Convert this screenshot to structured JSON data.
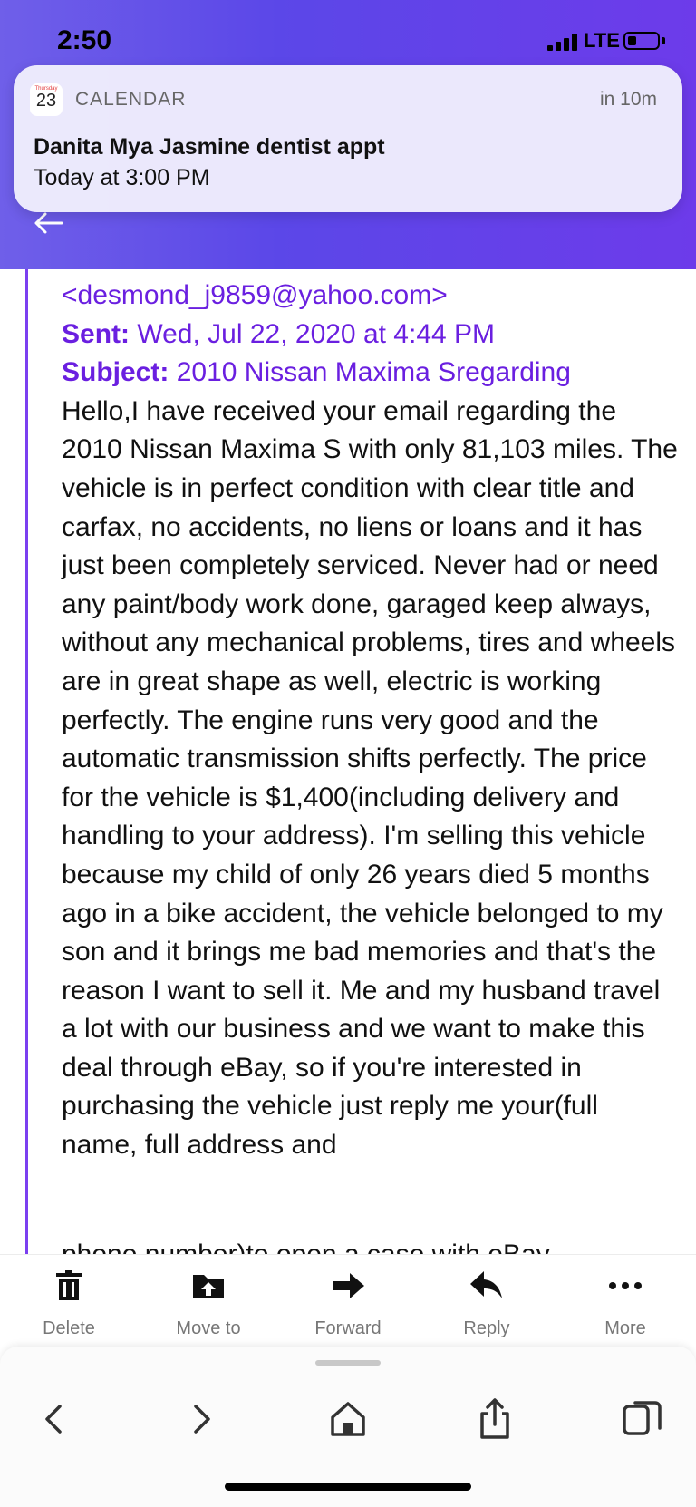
{
  "status_bar": {
    "time": "2:50",
    "network": "LTE"
  },
  "notification": {
    "icon_day": "Thursday",
    "icon_date": "23",
    "app": "CALENDAR",
    "when": "in 10m",
    "title": "Danita Mya Jasmine dentist appt",
    "subtitle": "Today at 3:00 PM"
  },
  "email": {
    "from_email": "<desmond_j9859@yahoo.com>",
    "sent_label": "Sent:",
    "sent_value": "Wed, Jul 22, 2020 at 4:44 PM",
    "subject_label": "Subject:",
    "subject_value": "2010 Nissan Maxima Sregarding",
    "body": "Hello,I have received your email regarding the 2010 Nissan Maxima S with only 81,103 miles. The vehicle is in perfect condition with clear title and carfax, no accidents, no liens or loans and it has just been completely serviced. Never had or need any paint/body work done, garaged keep always, without any mechanical problems, tires and wheels are in great shape as well, electric is working perfectly. The engine runs very good and the automatic transmission shifts perfectly. The price for the vehicle is $1,400(including delivery and handling to your address). I'm selling this vehicle because my child of only 26 years died 5 months ago in a bike accident, the vehicle belonged to my son and it brings me bad memories and that's the reason I want to sell it. Me and my husband travel a lot with our business and we want to make this deal through eBay, so if you're interested in purchasing the vehicle just reply me your(full name, full address and",
    "cut_line": "phone number)to open a case with eBay"
  },
  "toolbar": {
    "delete": "Delete",
    "move_to": "Move to",
    "forward": "Forward",
    "reply": "Reply",
    "more": "More"
  },
  "colors": {
    "header": "#5b47e8",
    "accent": "#6a1fe0"
  }
}
